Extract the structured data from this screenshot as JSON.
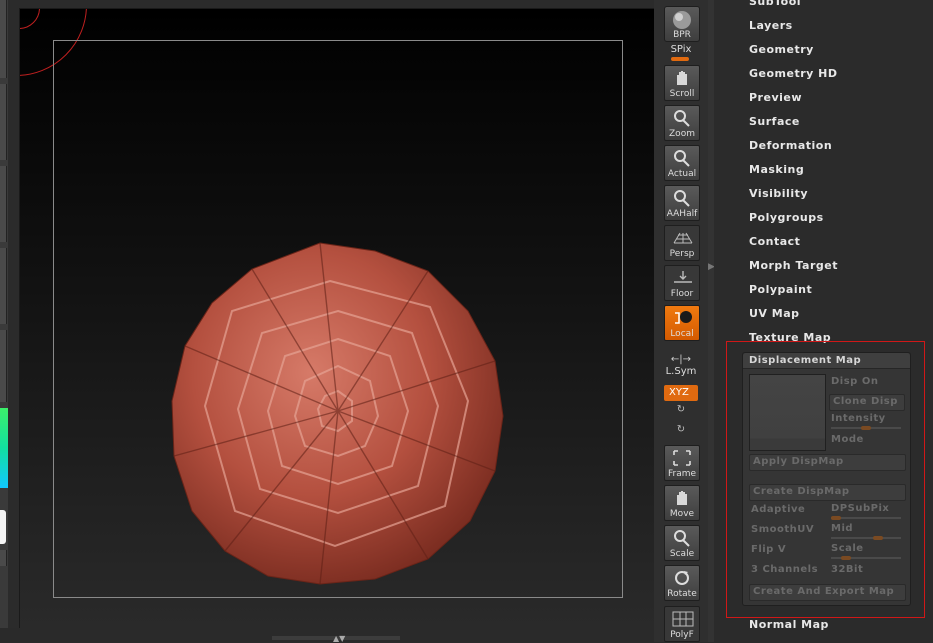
{
  "toolbar": {
    "bpr": "BPR",
    "spix": "SPix",
    "scroll": "Scroll",
    "zoom": "Zoom",
    "actual": "Actual",
    "aahalf": "AAHalf",
    "persp": "Persp",
    "floor": "Floor",
    "local": "Local",
    "lsym": "L.Sym",
    "xyz": "XYZ",
    "frame": "Frame",
    "move": "Move",
    "scale": "Scale",
    "rotate": "Rotate",
    "polyf": "PolyF"
  },
  "menu": {
    "items": [
      "SubTool",
      "Layers",
      "Geometry",
      "Geometry HD",
      "Preview",
      "Surface",
      "Deformation",
      "Masking",
      "Visibility",
      "Polygroups",
      "Contact",
      "Morph Target",
      "Polypaint",
      "UV Map",
      "Texture Map"
    ],
    "normal_map": "Normal Map"
  },
  "displacement": {
    "title": "Displacement Map",
    "disp_on": "Disp On",
    "clone_disp": "Clone Disp",
    "intensity": "Intensity",
    "mode": "Mode",
    "apply": "Apply DispMap",
    "create": "Create DispMap",
    "adaptive": "Adaptive",
    "dpsubpix": "DPSubPix",
    "smoothuv": "SmoothUV",
    "mid": "Mid",
    "flipv": "Flip V",
    "scale": "Scale",
    "channels": "3 Channels",
    "bit32": "32Bit",
    "export": "Create And Export Map"
  },
  "colors": {
    "accent": "#e06a10",
    "highlight": "#d01818",
    "mesh": "#b85848"
  }
}
